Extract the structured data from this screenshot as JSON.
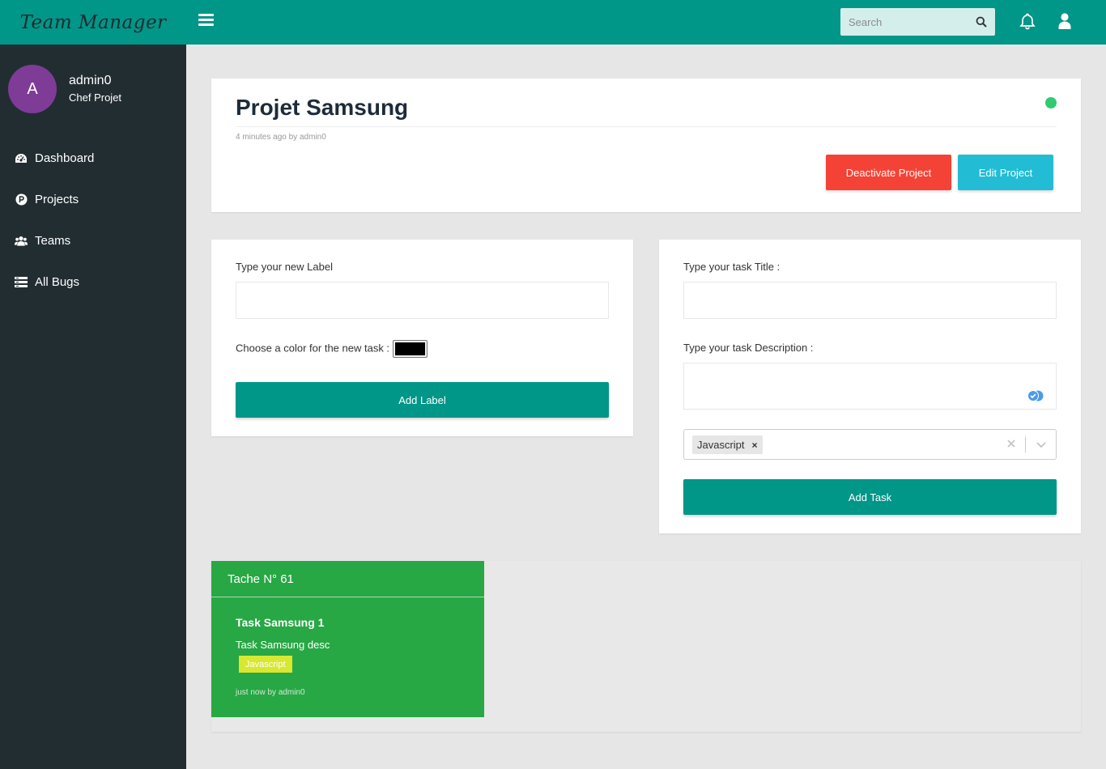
{
  "brand": {
    "name": "Team Manager"
  },
  "user": {
    "initial": "A",
    "name": "admin0",
    "role": "Chef Projet"
  },
  "nav": {
    "items": [
      {
        "label": "Dashboard",
        "icon": "dashboard-icon"
      },
      {
        "label": "Projects",
        "icon": "p-circle-icon"
      },
      {
        "label": "Teams",
        "icon": "users-icon"
      },
      {
        "label": "All Bugs",
        "icon": "list-icon"
      }
    ]
  },
  "topbar": {
    "search_placeholder": "Search"
  },
  "project": {
    "title": "Projet Samsung",
    "meta_time": "4 minutes ago by",
    "meta_author": "admin0",
    "status_color": "#2ecc71",
    "deactivate_label": "Deactivate Project",
    "edit_label": "Edit Project"
  },
  "label_form": {
    "label_prompt": "Type your new Label",
    "color_prompt": "Choose a color for the new task :",
    "color_value": "#000000",
    "submit_label": "Add Label"
  },
  "task_form": {
    "title_prompt": "Type your task Title :",
    "desc_prompt": "Type your task Description :",
    "selected_tag": "Javascript",
    "tag_remove": "×",
    "submit_label": "Add Task"
  },
  "board": {
    "lane_title": "Tache N° 61",
    "lane_color": "#28a745",
    "task": {
      "title": "Task Samsung 1",
      "description": "Task Samsung desc",
      "tag": "Javascript",
      "tag_color": "#d8e730",
      "meta_time": "just now by",
      "meta_author": "admin0"
    }
  },
  "colors": {
    "primary": "#009688",
    "sidebar": "#222d32",
    "danger": "#f44336",
    "info": "#22bcd4",
    "avatar": "#7e3c97"
  }
}
